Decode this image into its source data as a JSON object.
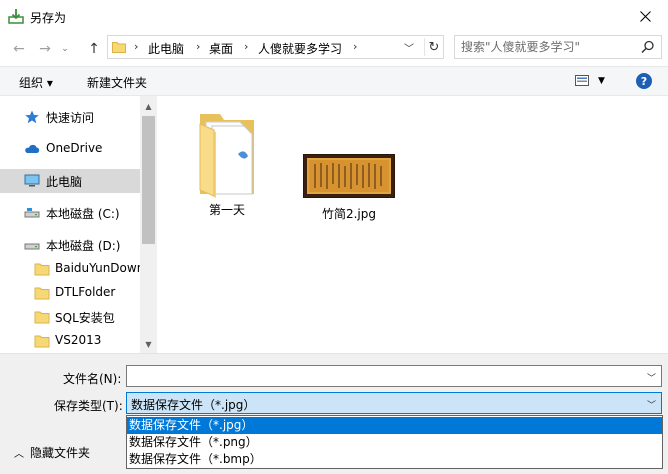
{
  "window": {
    "title": "另存为"
  },
  "address": {
    "crumbs": [
      "此电脑",
      "桌面",
      "人傻就要多学习"
    ],
    "separator": "›"
  },
  "search": {
    "placeholder": "搜索\"人傻就要多学习\""
  },
  "toolbar": {
    "organize_label": "组织 ▾",
    "new_folder_label": "新建文件夹"
  },
  "nav_pane": {
    "items": [
      {
        "label": "快速访问",
        "icon": "star-icon"
      },
      {
        "label": "OneDrive",
        "icon": "cloud-icon"
      },
      {
        "label": "此电脑",
        "icon": "computer-icon"
      },
      {
        "label": "本地磁盘 (C:)",
        "icon": "drive-icon"
      },
      {
        "label": "本地磁盘 (D:)",
        "icon": "drive-icon"
      },
      {
        "label": "BaiduYunDown",
        "icon": "folder-icon"
      },
      {
        "label": "DTLFolder",
        "icon": "folder-icon"
      },
      {
        "label": "SQL安装包",
        "icon": "folder-icon"
      },
      {
        "label": "VS2013",
        "icon": "folder-icon"
      }
    ]
  },
  "files": [
    {
      "name": "第一天",
      "type": "folder"
    },
    {
      "name": "竹简2.jpg",
      "type": "image"
    }
  ],
  "form": {
    "filename_label": "文件名(N):",
    "filename_value": "",
    "filetype_label": "保存类型(T):",
    "filetype_value": "数据保存文件（*.jpg）",
    "filetype_options": [
      "数据保存文件（*.jpg）",
      "数据保存文件（*.png）",
      "数据保存文件（*.bmp）"
    ],
    "hide_folders_label": "隐藏文件夹"
  },
  "colors": {
    "accent": "#0078d7",
    "selection": "#cce8ff",
    "folder": "#f8d775",
    "help": "#1e5fb4"
  }
}
